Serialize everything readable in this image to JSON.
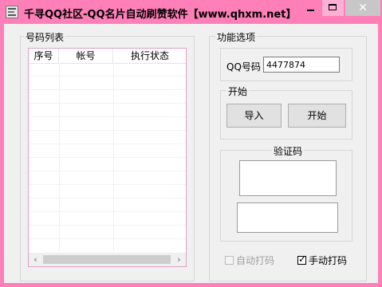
{
  "window": {
    "title": "千寻QQ社区-QQ名片自动刷赞软件【www.qhxm.net】",
    "minimize_glyph": "",
    "close_glyph": "✕"
  },
  "list_panel": {
    "label": "号码列表",
    "columns": [
      "序号",
      "帐号",
      "执行状态"
    ],
    "scroll_left": "‹",
    "scroll_right": "›"
  },
  "options_panel": {
    "label": "功能选项",
    "qq_label": "QQ号码",
    "qq_value": "4477874",
    "start_group_label": "开始",
    "import_button": "导入",
    "start_button": "开始",
    "captcha_label": "验证码",
    "auto_captcha_label": "自动打码",
    "auto_captcha_checked": false,
    "auto_captcha_enabled": false,
    "manual_captcha_label": "手动打码",
    "manual_captcha_checked": true
  },
  "icons": [
    "app-icon",
    "minimize-icon",
    "maximize-icon",
    "close-icon",
    "scroll-left-arrow-icon",
    "scroll-right-arrow-icon",
    "checkmark-icon"
  ],
  "colors": {
    "titlebar": "#ff7fb8",
    "close_button": "#c7c7c7",
    "window_bg": "#f0f0f0"
  }
}
